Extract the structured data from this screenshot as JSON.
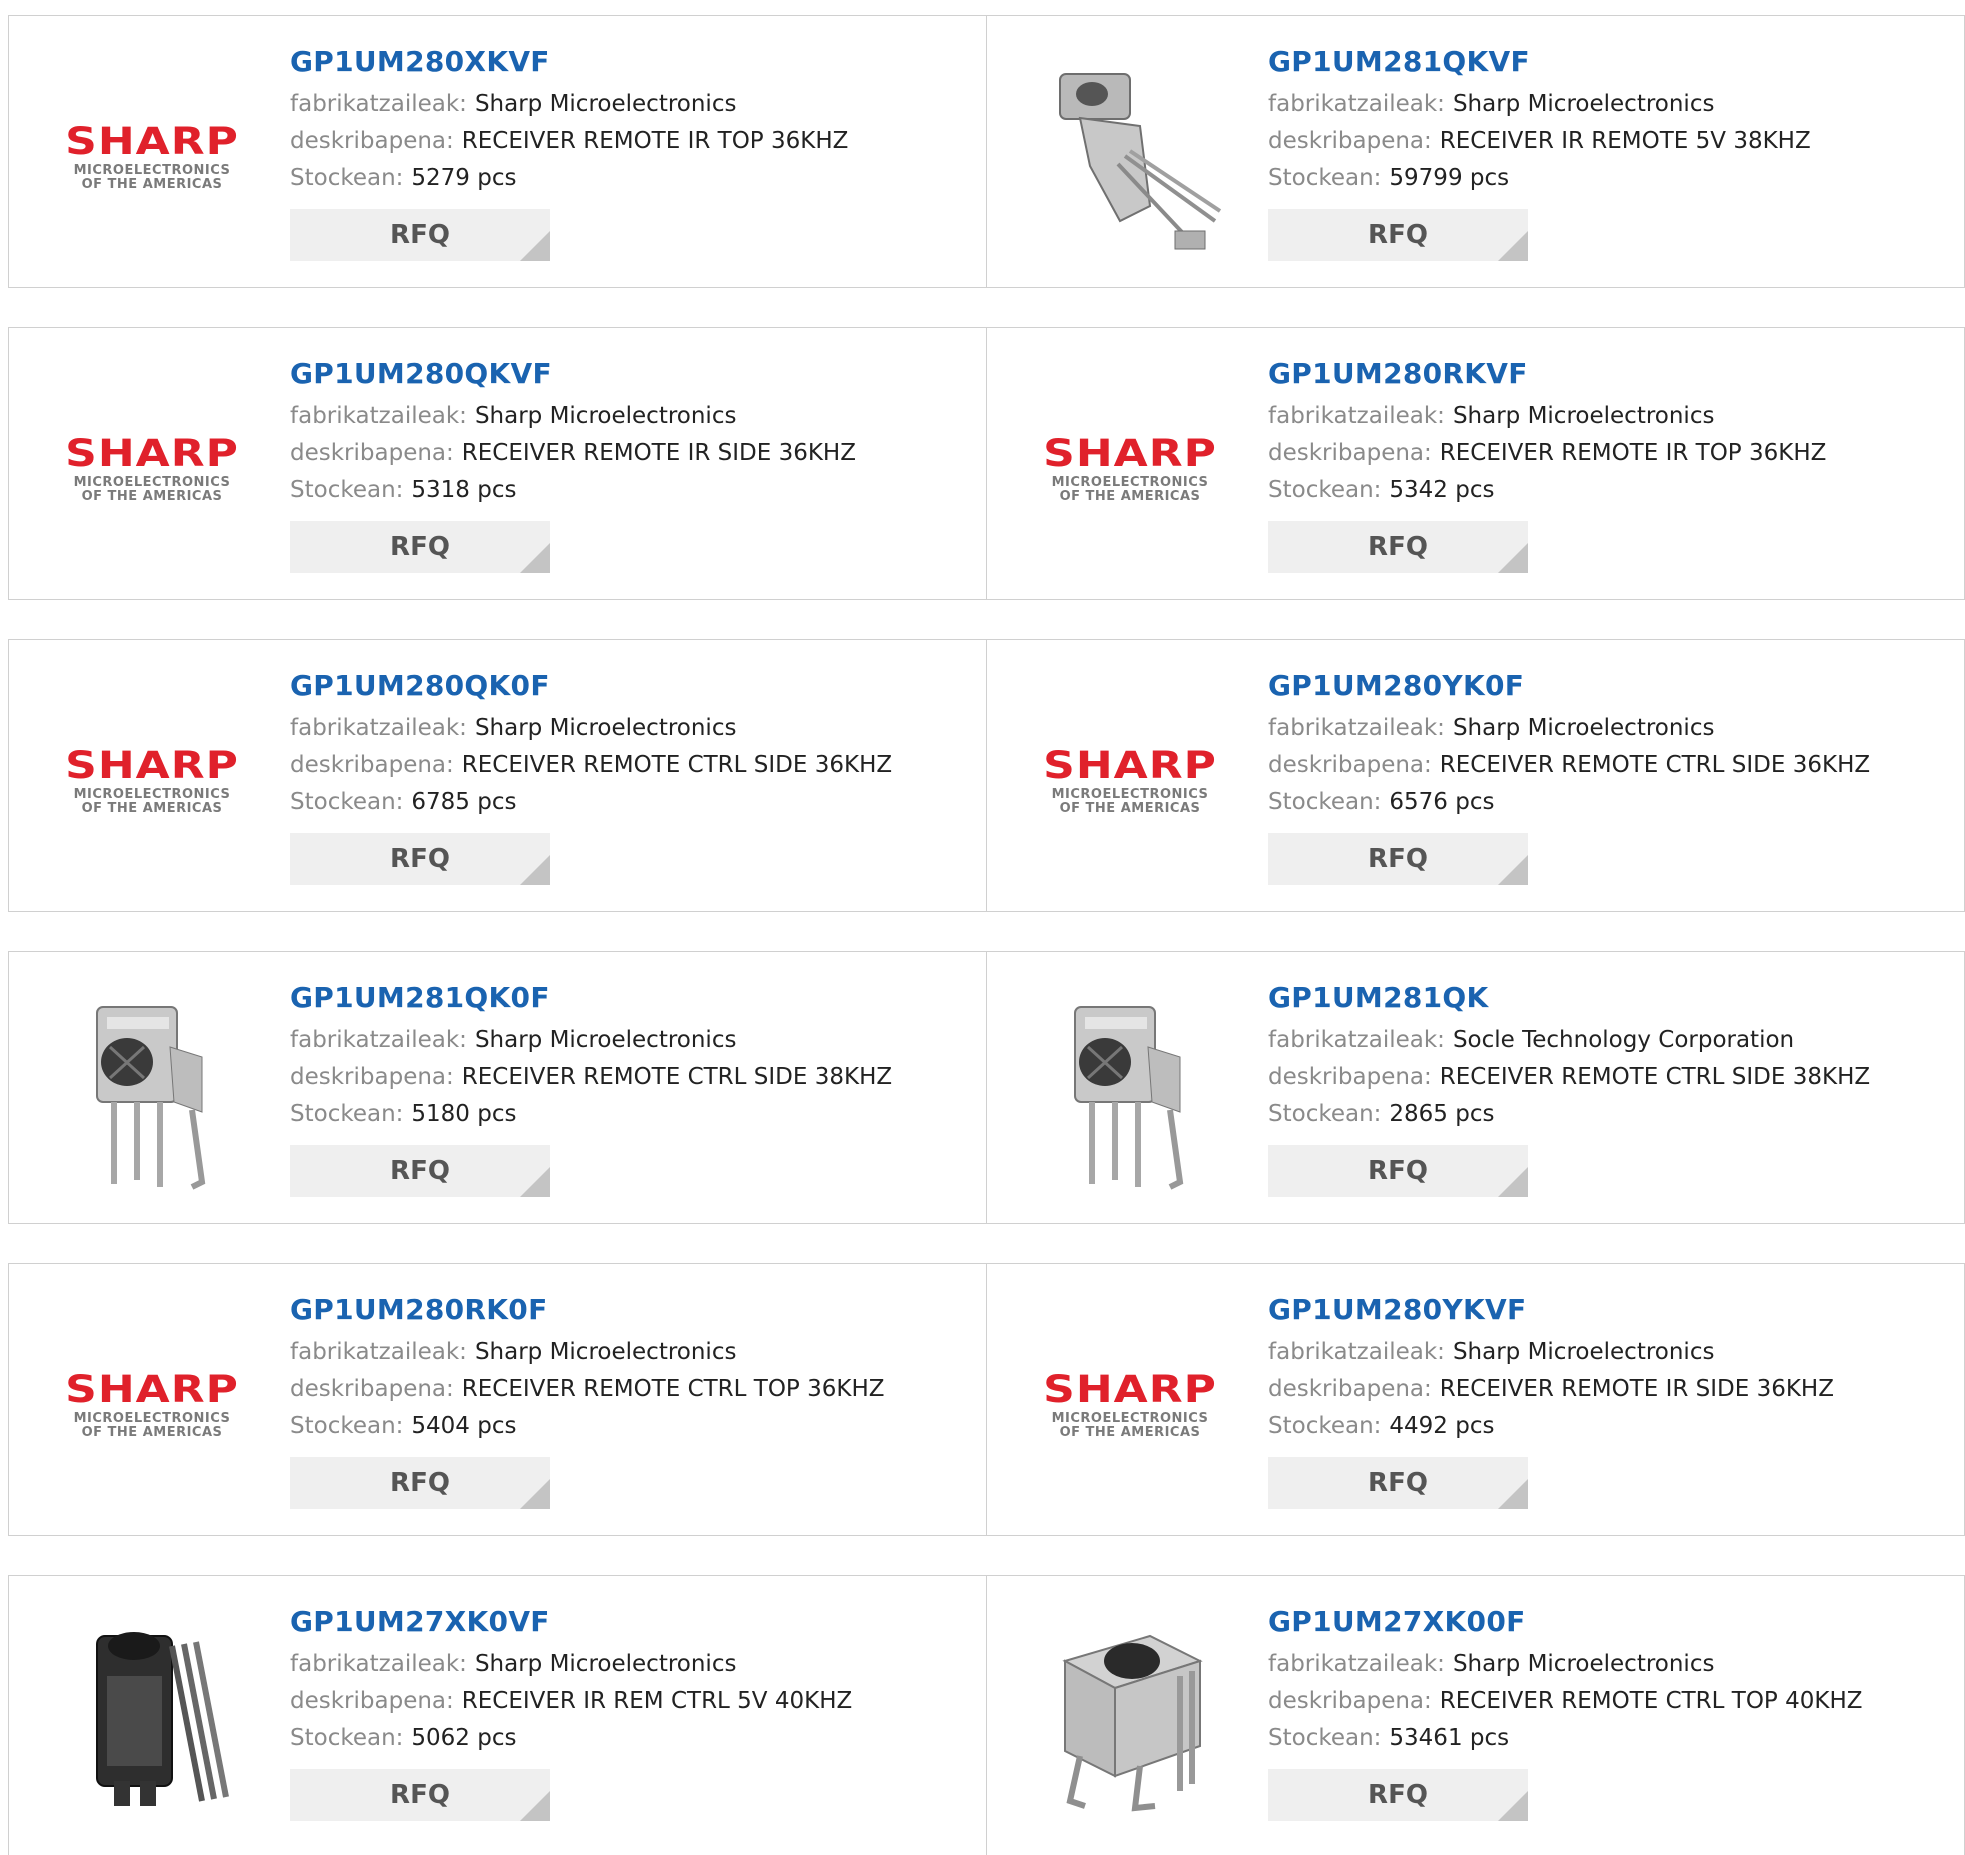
{
  "labels": {
    "manufacturer": "fabrikatzaileak:",
    "description": "deskribapena:",
    "stock": "Stockean:",
    "rfq": "RFQ"
  },
  "logo": {
    "word": "SHARP",
    "line1": "MICROELECTRONICS",
    "line2": "OF THE AMERICAS"
  },
  "colors": {
    "part_number": "#1a63b0",
    "logo_red": "#e0212b",
    "rfq_bg": "#efefef"
  },
  "products": [
    {
      "part": "GP1UM280XKVF",
      "manufacturer": "Sharp Microelectronics",
      "description": "RECEIVER REMOTE IR TOP 36KHZ",
      "stock": "5279 pcs",
      "image": "sharp-logo"
    },
    {
      "part": "GP1UM281QKVF",
      "manufacturer": "Sharp Microelectronics",
      "description": "RECEIVER IR REMOTE 5V 38KHZ",
      "stock": "59799 pcs",
      "image": "ir-receiver-angled-photo"
    },
    {
      "part": "GP1UM280QKVF",
      "manufacturer": "Sharp Microelectronics",
      "description": "RECEIVER REMOTE IR SIDE 36KHZ",
      "stock": "5318 pcs",
      "image": "sharp-logo"
    },
    {
      "part": "GP1UM280RKVF",
      "manufacturer": "Sharp Microelectronics",
      "description": "RECEIVER REMOTE IR TOP 36KHZ",
      "stock": "5342 pcs",
      "image": "sharp-logo"
    },
    {
      "part": "GP1UM280QK0F",
      "manufacturer": "Sharp Microelectronics",
      "description": "RECEIVER REMOTE CTRL SIDE 36KHZ",
      "stock": "6785 pcs",
      "image": "sharp-logo"
    },
    {
      "part": "GP1UM280YK0F",
      "manufacturer": "Sharp Microelectronics",
      "description": "RECEIVER REMOTE CTRL SIDE 36KHZ",
      "stock": "6576 pcs",
      "image": "sharp-logo"
    },
    {
      "part": "GP1UM281QK0F",
      "manufacturer": "Sharp Microelectronics",
      "description": "RECEIVER REMOTE CTRL SIDE 38KHZ",
      "stock": "5180 pcs",
      "image": "ir-receiver-side-photo"
    },
    {
      "part": "GP1UM281QK",
      "manufacturer": "Socle Technology Corporation",
      "description": "RECEIVER REMOTE CTRL SIDE 38KHZ",
      "stock": "2865 pcs",
      "image": "ir-receiver-side-photo"
    },
    {
      "part": "GP1UM280RK0F",
      "manufacturer": "Sharp Microelectronics",
      "description": "RECEIVER REMOTE CTRL TOP 36KHZ",
      "stock": "5404 pcs",
      "image": "sharp-logo"
    },
    {
      "part": "GP1UM280YKVF",
      "manufacturer": "Sharp Microelectronics",
      "description": "RECEIVER REMOTE IR SIDE 36KHZ",
      "stock": "4492 pcs",
      "image": "sharp-logo"
    },
    {
      "part": "GP1UM27XK0VF",
      "manufacturer": "Sharp Microelectronics",
      "description": "RECEIVER IR REM CTRL 5V 40KHZ",
      "stock": "5062 pcs",
      "image": "ir-receiver-black-photo"
    },
    {
      "part": "GP1UM27XK00F",
      "manufacturer": "Sharp Microelectronics",
      "description": "RECEIVER REMOTE CTRL TOP 40KHZ",
      "stock": "53461 pcs",
      "image": "ir-receiver-top-photo"
    }
  ]
}
